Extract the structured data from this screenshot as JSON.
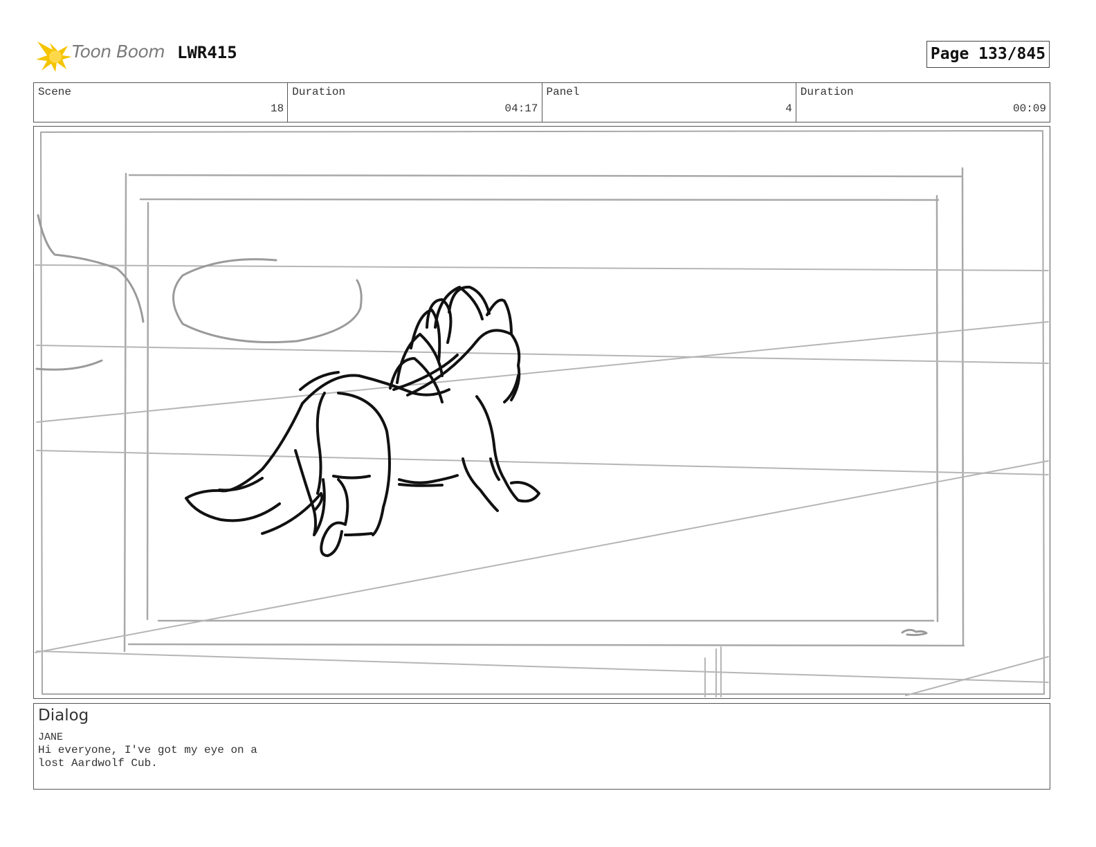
{
  "header": {
    "logo_text": "Toon Boom",
    "project_code": "LWR415",
    "page_label": "Page 133/845"
  },
  "info": {
    "scene_label": "Scene",
    "scene_value": "18",
    "scene_duration_label": "Duration",
    "scene_duration_value": "04:17",
    "panel_label": "Panel",
    "panel_value": "4",
    "panel_duration_label": "Duration",
    "panel_duration_value": "00:09"
  },
  "dialog": {
    "title": "Dialog",
    "character": "JANE",
    "lines": [
      "Hi everyone, I've got my eye on a",
      "lost Aardwolf Cub."
    ]
  },
  "colors": {
    "logo_accent": "#f5c400",
    "sketch_grey": "#aaaaaa",
    "sketch_black": "#111111"
  }
}
